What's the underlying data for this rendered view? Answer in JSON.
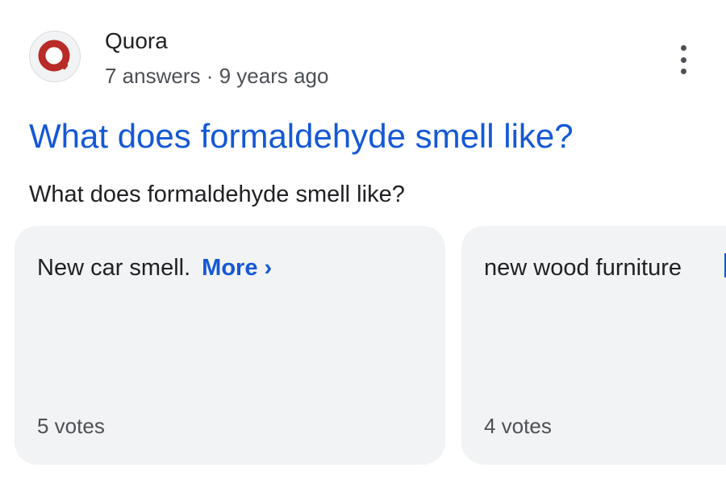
{
  "source": {
    "site_name": "Quora",
    "meta": "7 answers · 9 years ago",
    "favicon_icon": "quora-logo-icon",
    "menu_icon": "more-vertical-icon"
  },
  "result": {
    "title": "What does formaldehyde smell like?",
    "snippet": "What does formaldehyde smell like?"
  },
  "answers": [
    {
      "text": "New car smell.",
      "more_label": "More",
      "more_icon": "chevron-right-icon",
      "votes": "5 votes"
    },
    {
      "text": "new wood furniture",
      "votes": "4 votes"
    }
  ],
  "colors": {
    "link": "#1558d6",
    "card_bg": "#f1f3f4",
    "quora_red": "#b92b27",
    "secondary_text": "#4d5156"
  }
}
